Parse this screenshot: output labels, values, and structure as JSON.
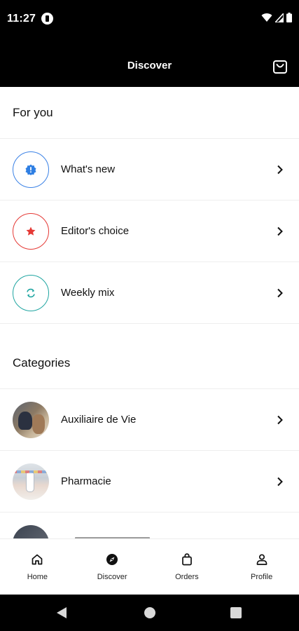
{
  "status_bar": {
    "time": "11:27"
  },
  "app_bar": {
    "title": "Discover"
  },
  "for_you": {
    "heading": "For you",
    "items": [
      {
        "label": "What's new",
        "icon": "alert-badge-icon",
        "color": "#3b82e6"
      },
      {
        "label": "Editor's choice",
        "icon": "star-icon",
        "color": "#e53935"
      },
      {
        "label": "Weekly mix",
        "icon": "refresh-icon",
        "color": "#1fa5a1"
      }
    ]
  },
  "categories": {
    "heading": "Categories",
    "items": [
      {
        "label": "Auxiliaire de Vie"
      },
      {
        "label": "Pharmacie"
      }
    ]
  },
  "bottom_nav": {
    "items": [
      {
        "label": "Home",
        "icon": "home-icon"
      },
      {
        "label": "Discover",
        "icon": "compass-icon",
        "active": true
      },
      {
        "label": "Orders",
        "icon": "shopping-bag-icon"
      },
      {
        "label": "Profile",
        "icon": "person-icon"
      }
    ]
  }
}
